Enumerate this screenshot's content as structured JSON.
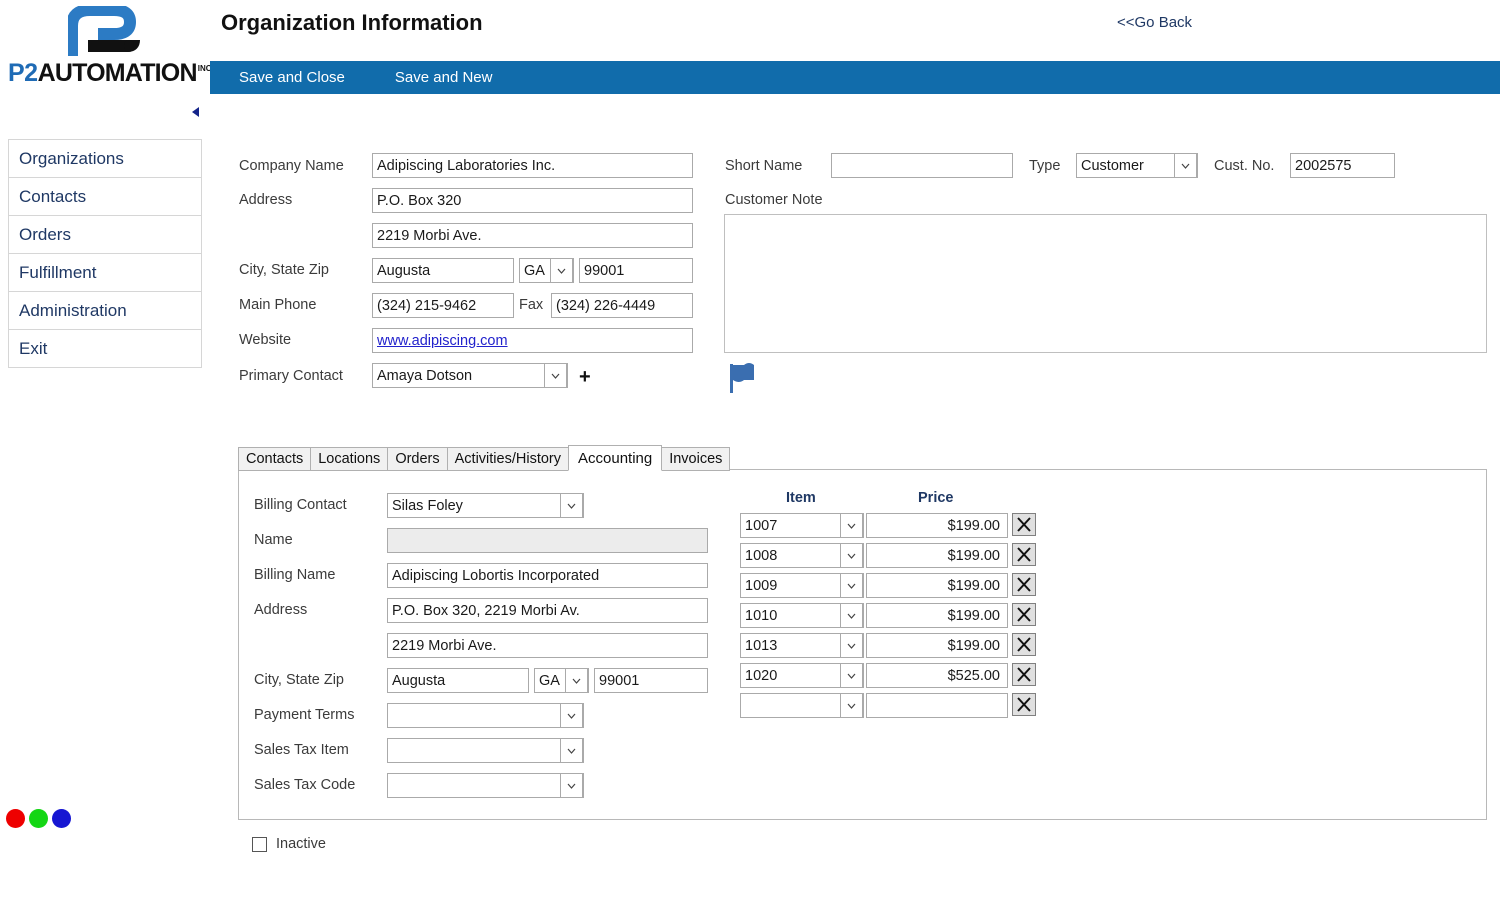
{
  "brand": {
    "logo_p2": "P2",
    "logo_word": "AUTOMATION",
    "logo_suffix": "INC"
  },
  "sidebar": {
    "items": [
      {
        "label": "Organizations"
      },
      {
        "label": "Contacts"
      },
      {
        "label": "Orders"
      },
      {
        "label": "Fulfillment"
      },
      {
        "label": "Administration"
      },
      {
        "label": "Exit"
      }
    ],
    "collapse_icon": "collapse-left-icon",
    "status_dots": [
      {
        "name": "red-dot",
        "color": "#ee0000"
      },
      {
        "name": "green-dot",
        "color": "#14d614"
      },
      {
        "name": "blue-dot",
        "color": "#1616d2"
      }
    ]
  },
  "header": {
    "title": "Organization Information",
    "go_back": "<<Go Back"
  },
  "toolbar": {
    "background": "#116cab",
    "save_and_close": "Save and Close",
    "save_and_new": "Save and New"
  },
  "org_form": {
    "company_name_label": "Company Name",
    "company_name_value": "Adipiscing Laboratories Inc.",
    "address_label": "Address",
    "address_line1_value": "P.O. Box 320",
    "address_line2_value": "2219 Morbi Ave.",
    "city_state_zip_label": "City, State Zip",
    "city_value": "Augusta",
    "state_value": "GA",
    "zip_value": "99001",
    "main_phone_label": "Main Phone",
    "main_phone_value": "(324) 215-9462",
    "fax_label": "Fax",
    "fax_value": "(324) 226-4449",
    "website_label": "Website",
    "website_value": "www.adipiscing.com",
    "primary_contact_label": "Primary Contact",
    "primary_contact_value": "Amaya Dotson",
    "add_contact_label": "+",
    "short_name_label": "Short Name",
    "short_name_value": "",
    "type_label": "Type",
    "type_value": "Customer",
    "cust_no_label": "Cust. No.",
    "cust_no_value": "2002575",
    "customer_note_label": "Customer Note",
    "customer_note_value": "",
    "flag_icon": "flag-icon",
    "flag_color": "#3a6eb0"
  },
  "tabs": {
    "items": [
      {
        "label": "Contacts",
        "active": false
      },
      {
        "label": "Locations",
        "active": false
      },
      {
        "label": "Orders",
        "active": false
      },
      {
        "label": "Activities/History",
        "active": false
      },
      {
        "label": "Accounting",
        "active": true
      },
      {
        "label": "Invoices",
        "active": false
      }
    ]
  },
  "accounting": {
    "billing_contact_label": "Billing Contact",
    "billing_contact_value": "Silas Foley",
    "name_label": "Name",
    "name_value": "",
    "billing_name_label": "Billing Name",
    "billing_name_value": "Adipiscing Lobortis Incorporated",
    "address_label": "Address",
    "address_line1_value": "P.O. Box 320, 2219 Morbi Av.",
    "address_line2_value": "2219 Morbi Ave.",
    "city_state_zip_label": "City, State Zip",
    "city_value": "Augusta",
    "state_value": "GA",
    "zip_value": "99001",
    "payment_terms_label": "Payment Terms",
    "payment_terms_value": "",
    "sales_tax_item_label": "Sales Tax Item",
    "sales_tax_item_value": "",
    "sales_tax_code_label": "Sales Tax Code",
    "sales_tax_code_value": "",
    "table": {
      "col_item": "Item",
      "col_price": "Price",
      "rows": [
        {
          "item": "1007",
          "price": "$199.00"
        },
        {
          "item": "1008",
          "price": "$199.00"
        },
        {
          "item": "1009",
          "price": "$199.00"
        },
        {
          "item": "1010",
          "price": "$199.00"
        },
        {
          "item": "1013",
          "price": "$199.00"
        },
        {
          "item": "1020",
          "price": "$525.00"
        },
        {
          "item": "",
          "price": ""
        }
      ],
      "delete_icon": "close-x-icon"
    }
  },
  "footer": {
    "inactive_label": "Inactive",
    "inactive_checked": false
  }
}
